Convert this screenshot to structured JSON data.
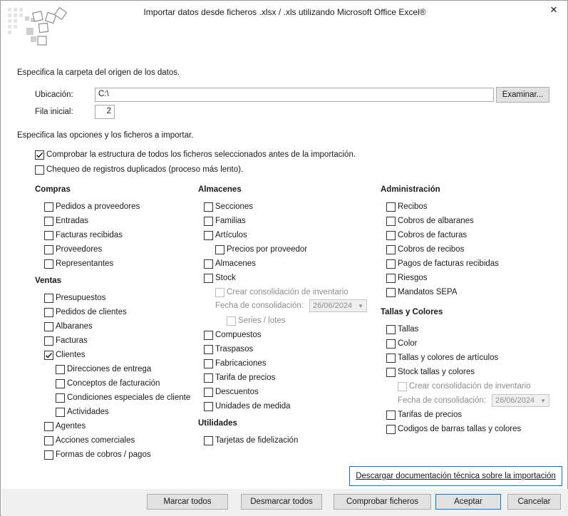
{
  "window": {
    "title": "Importar datos desde ficheros .xlsx / .xls utilizando Microsoft Office Excel®",
    "close_glyph": "✕"
  },
  "origin": {
    "heading": "Especifica la carpeta del origen de los datos.",
    "location_label": "Ubicación:",
    "location_value": "C:\\",
    "browse_label": "Examinar...",
    "start_row_label": "Fila inicial:",
    "start_row_value": "2"
  },
  "options": {
    "heading": "Especifica las opciones y los ficheros a importar.",
    "check_structure": {
      "label": "Comprobar la estructura de todos los ficheros seleccionados antes de la importación.",
      "checked": true
    },
    "check_duplicates": {
      "label": "Chequeo de registros duplicados (proceso más lento).",
      "checked": false
    }
  },
  "compras": {
    "title": "Compras",
    "items": [
      {
        "label": "Pedidos a proveedores",
        "checked": false
      },
      {
        "label": "Entradas",
        "checked": false
      },
      {
        "label": "Facturas recibidas",
        "checked": false
      },
      {
        "label": "Proveedores",
        "checked": false
      },
      {
        "label": "Representantes",
        "checked": false
      }
    ]
  },
  "ventas": {
    "title": "Ventas",
    "items": [
      {
        "label": "Presupuestos",
        "checked": false
      },
      {
        "label": "Pedidos de clientes",
        "checked": false
      },
      {
        "label": "Albaranes",
        "checked": false
      },
      {
        "label": "Facturas",
        "checked": false
      },
      {
        "label": "Clientes",
        "checked": true
      },
      {
        "label": "Direcciones de entrega",
        "checked": false
      },
      {
        "label": "Conceptos de facturación",
        "checked": false
      },
      {
        "label": "Condiciones especiales de cliente",
        "checked": false
      },
      {
        "label": "Actividades",
        "checked": false
      },
      {
        "label": "Agentes",
        "checked": false
      },
      {
        "label": "Acciones comerciales",
        "checked": false
      },
      {
        "label": "Formas de cobros / pagos",
        "checked": false
      }
    ]
  },
  "almacenes": {
    "title": "Almacenes",
    "items": [
      {
        "label": "Secciones",
        "checked": false
      },
      {
        "label": "Familias",
        "checked": false
      },
      {
        "label": "Artículos",
        "checked": false
      },
      {
        "label": "Precios por proveedor",
        "checked": false
      },
      {
        "label": "Almacenes",
        "checked": false
      },
      {
        "label": "Stock",
        "checked": false
      },
      {
        "label": "Crear consolidación de inventario",
        "checked": false
      },
      {
        "label": "Series / lotes",
        "checked": false
      },
      {
        "label": "Compuestos",
        "checked": false
      },
      {
        "label": "Traspasos",
        "checked": false
      },
      {
        "label": "Fabricaciones",
        "checked": false
      },
      {
        "label": "Tarifa de precios",
        "checked": false
      },
      {
        "label": "Descuentos",
        "checked": false
      },
      {
        "label": "Unidades de medida",
        "checked": false
      }
    ],
    "consolidation_date_label": "Fecha de consolidación:",
    "consolidation_date_value": "26/06/2024"
  },
  "utilidades": {
    "title": "Utilidades",
    "items": [
      {
        "label": "Tarjetas de fidelización",
        "checked": false
      }
    ]
  },
  "administracion": {
    "title": "Administración",
    "items": [
      {
        "label": "Recibos",
        "checked": false
      },
      {
        "label": "Cobros de albaranes",
        "checked": false
      },
      {
        "label": "Cobros de facturas",
        "checked": false
      },
      {
        "label": "Cobros de recibos",
        "checked": false
      },
      {
        "label": "Pagos de facturas recibidas",
        "checked": false
      },
      {
        "label": "Riesgos",
        "checked": false
      },
      {
        "label": "Mandatos SEPA",
        "checked": false
      }
    ]
  },
  "tallas": {
    "title": "Tallas y Colores",
    "items": [
      {
        "label": "Tallas",
        "checked": false
      },
      {
        "label": "Color",
        "checked": false
      },
      {
        "label": "Tallas y colores de artículos",
        "checked": false
      },
      {
        "label": "Stock tallas y colores",
        "checked": false
      },
      {
        "label": "Crear consolidación de inventario",
        "checked": false
      },
      {
        "label": "Tarifas de precios",
        "checked": false
      },
      {
        "label": "Codigos de barras tallas y colores",
        "checked": false
      }
    ],
    "consolidation_date_label": "Fecha de consolidación:",
    "consolidation_date_value": "26/06/2024"
  },
  "footer": {
    "doc_link": "Descargar documentación técnica sobre la importación",
    "mark_all": "Marcar todos",
    "unmark_all": "Desmarcar todos",
    "check_files": "Comprobar ficheros",
    "accept": "Aceptar",
    "cancel": "Cancelar"
  },
  "colors": {
    "accent": "#0078d7",
    "footer_bg": "#f0f0f0",
    "button_bg": "#e1e1e1"
  }
}
